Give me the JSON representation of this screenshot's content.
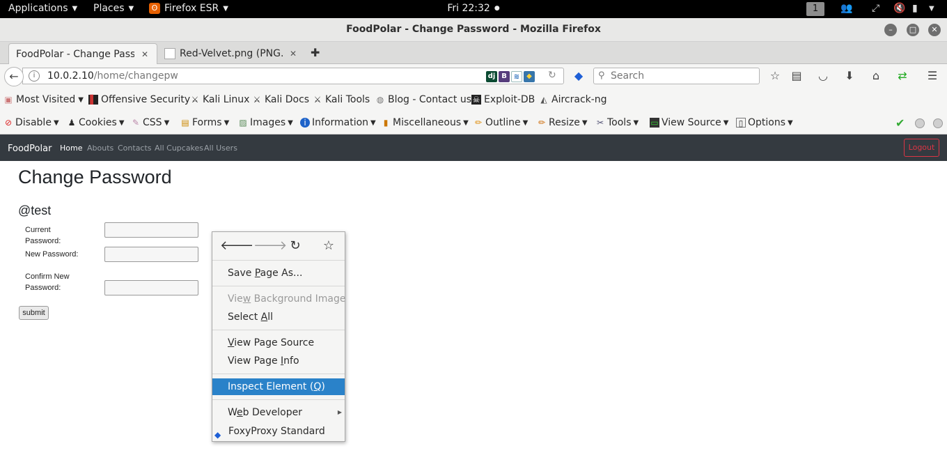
{
  "os_topbar": {
    "applications": "Applications",
    "places": "Places",
    "firefox_app": "Firefox ESR",
    "clock": "Fri 22:32",
    "workspace": "1"
  },
  "window": {
    "title": "FoodPolar - Change Password - Mozilla Firefox"
  },
  "tabs": [
    {
      "label": "FoodPolar - Change Pass..."
    },
    {
      "label": "Red-Velvet.png (PNG..."
    }
  ],
  "navbar": {
    "url_host": "10.0.2.10",
    "url_path": "/home/changepw",
    "search_placeholder": "Search"
  },
  "bookmarks": [
    {
      "label": "Most Visited",
      "icon": "folder-icon"
    },
    {
      "label": "Offensive Security",
      "icon": "offsec-icon"
    },
    {
      "label": "Kali Linux",
      "icon": "kali-icon"
    },
    {
      "label": "Kali Docs",
      "icon": "kali-icon"
    },
    {
      "label": "Kali Tools",
      "icon": "kali-icon"
    },
    {
      "label": "Blog - Contact us",
      "icon": "globe-icon"
    },
    {
      "label": "Exploit-DB",
      "icon": "exploitdb-icon"
    },
    {
      "label": "Aircrack-ng",
      "icon": "aircrack-icon"
    }
  ],
  "webdev_toolbar": [
    {
      "label": "Disable",
      "icon": "disable-icon"
    },
    {
      "label": "Cookies",
      "icon": "cookies-icon"
    },
    {
      "label": "CSS",
      "icon": "css-icon"
    },
    {
      "label": "Forms",
      "icon": "forms-icon"
    },
    {
      "label": "Images",
      "icon": "images-icon"
    },
    {
      "label": "Information",
      "icon": "information-icon"
    },
    {
      "label": "Miscellaneous",
      "icon": "miscellaneous-icon"
    },
    {
      "label": "Outline",
      "icon": "outline-icon"
    },
    {
      "label": "Resize",
      "icon": "resize-icon"
    },
    {
      "label": "Tools",
      "icon": "tools-icon"
    },
    {
      "label": "View Source",
      "icon": "view-source-icon"
    },
    {
      "label": "Options",
      "icon": "options-icon"
    }
  ],
  "site": {
    "brand": "FoodPolar",
    "nav": [
      "Home",
      "Abouts",
      "Contacts",
      "All Cupcakes",
      "All Users"
    ],
    "logout": "Logout"
  },
  "page": {
    "title": "Change Password",
    "username": "@test",
    "fields": [
      {
        "label": "Current Password:",
        "value": ""
      },
      {
        "label": "New Password:",
        "value": ""
      },
      {
        "label": "Confirm New Password:",
        "value": ""
      }
    ],
    "submit": "submit"
  },
  "context_menu": {
    "items": [
      {
        "text": "Save Page As...",
        "accel": "P",
        "state": "enabled"
      },
      {
        "text": "View Background Image",
        "accel": "w",
        "state": "disabled"
      },
      {
        "text": "Select All",
        "accel": "A",
        "state": "enabled"
      },
      {
        "text": "View Page Source",
        "accel": "V",
        "state": "enabled"
      },
      {
        "text": "View Page Info",
        "accel": "I",
        "state": "enabled"
      },
      {
        "text": "Inspect Element (Q)",
        "accel": "Q",
        "state": "highlighted"
      },
      {
        "text": "Web Developer",
        "accel": "e",
        "state": "submenu"
      },
      {
        "text": "FoxyProxy Standard",
        "accel": "",
        "state": "enabled"
      }
    ]
  },
  "colors": {
    "site_navbar": "#343a40",
    "menu_highlight": "#2a82c9",
    "logout_red": "#dc3545"
  }
}
